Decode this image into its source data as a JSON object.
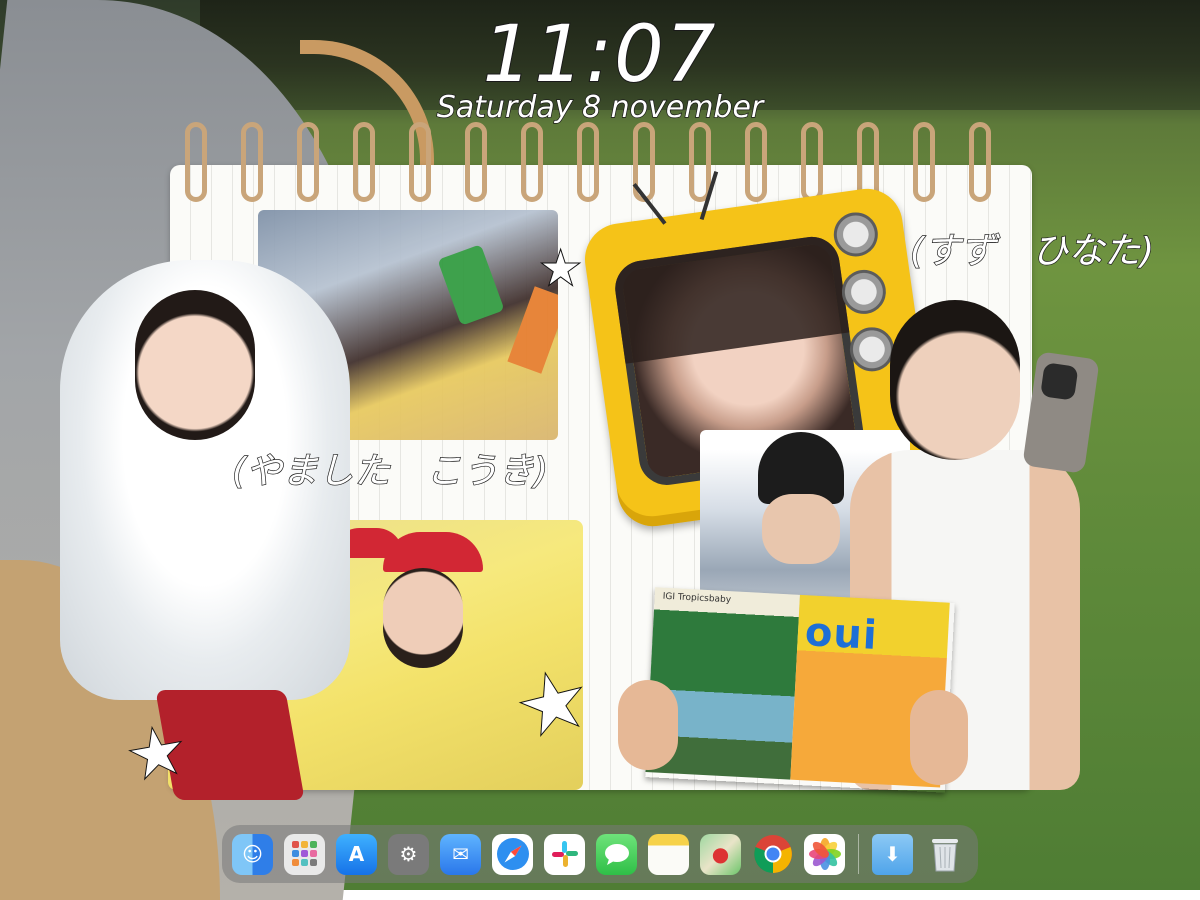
{
  "lockscreen": {
    "time": "11:07",
    "date": "Saturday 8 november"
  },
  "captions": {
    "right": "(すず　ひなた)",
    "left": "(やました　こうき)"
  },
  "magazine": {
    "cover_title": "oui",
    "spine_text": "IGI Tropicsbaby"
  },
  "dock": {
    "apps": [
      {
        "name": "Finder",
        "icon": "finder-icon",
        "color": "#2f8cf0"
      },
      {
        "name": "Launchpad",
        "icon": "launchpad-icon",
        "color": "#e6e6e6"
      },
      {
        "name": "App Store",
        "icon": "app-store-icon",
        "color": "#1a8cf5"
      },
      {
        "name": "System Settings",
        "icon": "settings-icon",
        "color": "#8a8a8a"
      },
      {
        "name": "Mail",
        "icon": "mail-icon",
        "color": "#3d8ef2"
      },
      {
        "name": "Safari",
        "icon": "safari-icon",
        "color": "#2d8ff0"
      },
      {
        "name": "Slack",
        "icon": "slack-icon",
        "color": "#ffffff"
      },
      {
        "name": "Messages",
        "icon": "messages-icon",
        "color": "#37c94d"
      },
      {
        "name": "Notes",
        "icon": "notes-icon",
        "color": "#f6d24a"
      },
      {
        "name": "Maps",
        "icon": "maps-icon",
        "color": "#6cc56a"
      },
      {
        "name": "Chrome",
        "icon": "chrome-icon",
        "color": "#ffffff"
      },
      {
        "name": "Photos",
        "icon": "photos-icon",
        "color": "#ffffff"
      },
      {
        "name": "Downloads",
        "icon": "downloads-folder-icon",
        "color": "#5fb1f0"
      },
      {
        "name": "Trash",
        "icon": "trash-icon",
        "color": "#d9dde0"
      }
    ]
  }
}
